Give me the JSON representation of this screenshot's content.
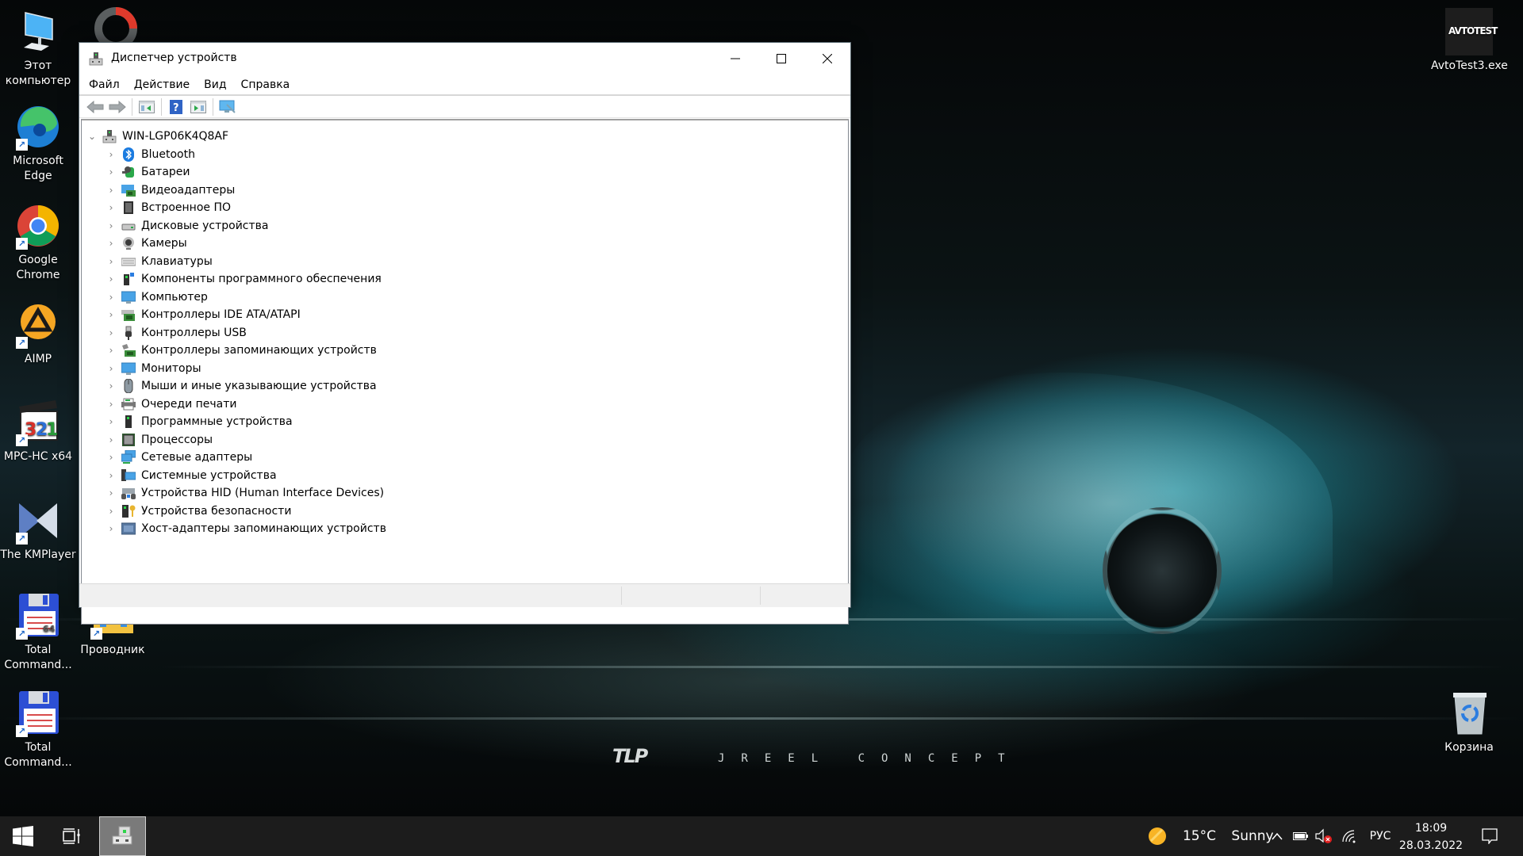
{
  "desktop": {
    "icons_left": [
      {
        "label": "Этот компьютер",
        "icon": "this-pc-icon"
      },
      {
        "label": "Microsoft Edge",
        "icon": "edge-icon"
      },
      {
        "label": "Google Chrome",
        "icon": "chrome-icon"
      },
      {
        "label": "AIMP",
        "icon": "aimp-icon"
      },
      {
        "label": "MPC-HC x64",
        "icon": "mpc-hc-icon"
      },
      {
        "label": "The KMPlayer",
        "icon": "kmplayer-icon"
      },
      {
        "label": "Total Command...",
        "icon": "total-commander-64-icon"
      },
      {
        "label": "Total Command...",
        "icon": "total-commander-icon"
      }
    ],
    "explorer_icon": {
      "label": "Проводник",
      "icon": "file-explorer-icon"
    },
    "avtotest_icon": {
      "label": "AvtoTest3.exe",
      "icon": "avtotest-icon",
      "badge_text": "AVTOTEST"
    },
    "recycle_bin": {
      "label": "Корзина",
      "icon": "recycle-bin-icon"
    },
    "wallpaper": {
      "brand_logo": "TLP",
      "brand_text": "JREEL CONCEPT"
    }
  },
  "window": {
    "title": "Диспетчер устройств",
    "menu": [
      "Файл",
      "Действие",
      "Вид",
      "Справка"
    ],
    "toolbar": [
      {
        "icon": "back-arrow-icon",
        "enabled": false
      },
      {
        "icon": "forward-arrow-icon",
        "enabled": false
      },
      {
        "icon": "show-hide-console-tree-icon",
        "enabled": true
      },
      {
        "icon": "help-icon",
        "enabled": true
      },
      {
        "icon": "show-action-pane-icon",
        "enabled": true
      },
      {
        "icon": "scan-hardware-icon",
        "enabled": true
      }
    ],
    "tree": {
      "root": {
        "label": "WIN-LGP06K4Q8AF",
        "expanded": true
      },
      "children": [
        {
          "label": "Bluetooth",
          "icon": "bluetooth-icon"
        },
        {
          "label": "Батареи",
          "icon": "battery-icon"
        },
        {
          "label": "Видеоадаптеры",
          "icon": "display-adapter-icon"
        },
        {
          "label": "Встроенное ПО",
          "icon": "firmware-icon"
        },
        {
          "label": "Дисковые устройства",
          "icon": "disk-drive-icon"
        },
        {
          "label": "Камеры",
          "icon": "camera-icon"
        },
        {
          "label": "Клавиатуры",
          "icon": "keyboard-icon"
        },
        {
          "label": "Компоненты программного обеспечения",
          "icon": "software-component-icon"
        },
        {
          "label": "Компьютер",
          "icon": "computer-icon"
        },
        {
          "label": "Контроллеры IDE ATA/ATAPI",
          "icon": "ide-controller-icon"
        },
        {
          "label": "Контроллеры USB",
          "icon": "usb-icon"
        },
        {
          "label": "Контроллеры запоминающих устройств",
          "icon": "storage-controller-icon"
        },
        {
          "label": "Мониторы",
          "icon": "monitor-icon"
        },
        {
          "label": "Мыши и иные указывающие устройства",
          "icon": "mouse-icon"
        },
        {
          "label": "Очереди печати",
          "icon": "printer-icon"
        },
        {
          "label": "Программные устройства",
          "icon": "software-device-icon"
        },
        {
          "label": "Процессоры",
          "icon": "processor-icon"
        },
        {
          "label": "Сетевые адаптеры",
          "icon": "network-adapter-icon"
        },
        {
          "label": "Системные устройства",
          "icon": "system-device-icon"
        },
        {
          "label": "Устройства HID (Human Interface Devices)",
          "icon": "hid-icon"
        },
        {
          "label": "Устройства безопасности",
          "icon": "security-device-icon"
        },
        {
          "label": "Хост-адаптеры запоминающих устройств",
          "icon": "storage-host-adapter-icon"
        }
      ]
    }
  },
  "taskbar": {
    "weather": {
      "temp": "15°C",
      "condition": "Sunny"
    },
    "language": "РУС",
    "time": "18:09",
    "date": "28.03.2022"
  },
  "colors": {
    "accent": "#0078d7",
    "taskbar_bg": "#1c1c1c",
    "window_bg": "#ffffff",
    "statusbar_bg": "#f0f0f0"
  }
}
